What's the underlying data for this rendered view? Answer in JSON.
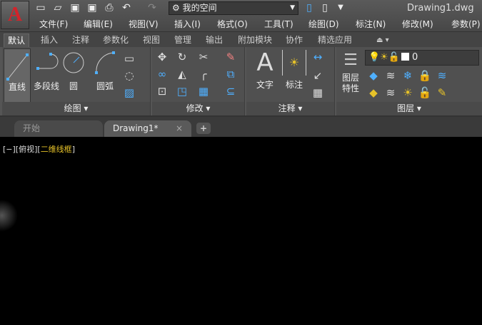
{
  "app": {
    "logo": "A",
    "title": "Drawing1.dwg",
    "workspace": "我的空间"
  },
  "quick_access": [
    "new-icon",
    "open-icon",
    "save-icon",
    "save-as-icon",
    "print-icon",
    "undo-icon",
    "redo-icon"
  ],
  "menu": [
    "文件(F)",
    "编辑(E)",
    "视图(V)",
    "插入(I)",
    "格式(O)",
    "工具(T)",
    "绘图(D)",
    "标注(N)",
    "修改(M)",
    "参数(P)"
  ],
  "ribbon_tabs": [
    "默认",
    "插入",
    "注释",
    "参数化",
    "视图",
    "管理",
    "输出",
    "附加模块",
    "协作",
    "精选应用"
  ],
  "panels": {
    "draw": {
      "label": "绘图",
      "tools": [
        "直线",
        "多段线",
        "圆",
        "圆弧"
      ]
    },
    "modify": {
      "label": "修改"
    },
    "annotation": {
      "label": "注释",
      "tools": [
        "文字",
        "标注"
      ]
    },
    "layers": {
      "label": "图层",
      "tools": [
        "图层\n特性"
      ],
      "tool_line1": "图层",
      "tool_line2": "特性",
      "current_layer": "0"
    }
  },
  "doc_tabs": [
    {
      "label": "开始"
    },
    {
      "label": "Drawing1*",
      "active": true
    }
  ],
  "viewport": {
    "p1": "[−][俯视][",
    "style": "二维线框",
    "p2": "]"
  },
  "colors": {
    "accent": "#4fb0ff",
    "logo": "#d3232a",
    "visual_style": "#e6c229"
  }
}
